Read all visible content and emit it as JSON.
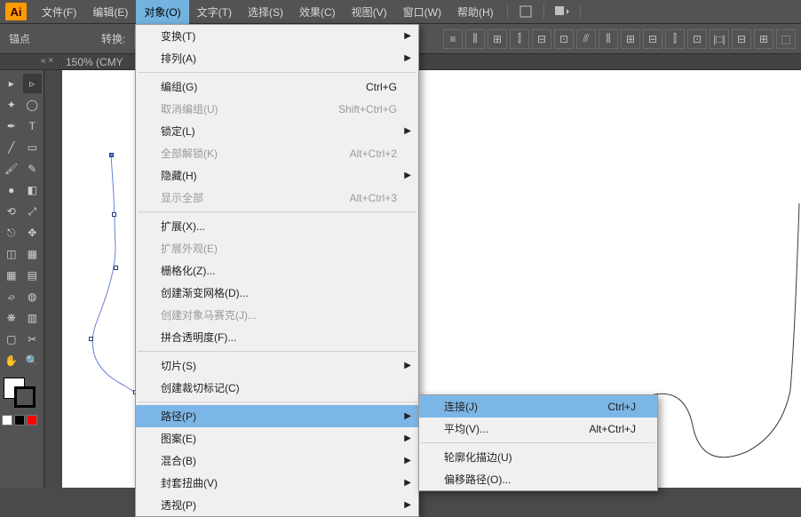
{
  "logo": "Ai",
  "menubar": [
    "文件(F)",
    "编辑(E)",
    "对象(O)",
    "文字(T)",
    "选择(S)",
    "效果(C)",
    "视图(V)",
    "窗口(W)",
    "帮助(H)"
  ],
  "menubar_active_index": 2,
  "toolbar": {
    "anchor_label": "锚点",
    "convert_label": "转换:"
  },
  "docbar": {
    "zoom_label": "150% (CMY",
    "close": "« ×"
  },
  "dropdown": [
    {
      "label": "变换(T)",
      "sub": true
    },
    {
      "label": "排列(A)",
      "sub": true
    },
    {
      "sep": true
    },
    {
      "label": "编组(G)",
      "shortcut": "Ctrl+G"
    },
    {
      "label": "取消编组(U)",
      "shortcut": "Shift+Ctrl+G",
      "disabled": true
    },
    {
      "label": "锁定(L)",
      "sub": true
    },
    {
      "label": "全部解锁(K)",
      "shortcut": "Alt+Ctrl+2",
      "disabled": true
    },
    {
      "label": "隐藏(H)",
      "sub": true
    },
    {
      "label": "显示全部",
      "shortcut": "Alt+Ctrl+3",
      "disabled": true
    },
    {
      "sep": true
    },
    {
      "label": "扩展(X)..."
    },
    {
      "label": "扩展外观(E)",
      "disabled": true
    },
    {
      "label": "栅格化(Z)..."
    },
    {
      "label": "创建渐变网格(D)..."
    },
    {
      "label": "创建对象马赛克(J)...",
      "disabled": true
    },
    {
      "label": "拼合透明度(F)..."
    },
    {
      "sep": true
    },
    {
      "label": "切片(S)",
      "sub": true
    },
    {
      "label": "创建裁切标记(C)"
    },
    {
      "sep": true
    },
    {
      "label": "路径(P)",
      "sub": true,
      "hover": true
    },
    {
      "label": "图案(E)",
      "sub": true
    },
    {
      "label": "混合(B)",
      "sub": true
    },
    {
      "label": "封套扭曲(V)",
      "sub": true
    },
    {
      "label": "透视(P)",
      "sub": true
    }
  ],
  "submenu": [
    {
      "label": "连接(J)",
      "shortcut": "Ctrl+J",
      "hover": true
    },
    {
      "label": "平均(V)...",
      "shortcut": "Alt+Ctrl+J"
    },
    {
      "sep": true
    },
    {
      "label": "轮廓化描边(U)"
    },
    {
      "label": "偏移路径(O)..."
    }
  ],
  "tools": [
    [
      "selection",
      "direct-selection"
    ],
    [
      "magic-wand",
      "lasso"
    ],
    [
      "pen",
      "type"
    ],
    [
      "line",
      "rectangle"
    ],
    [
      "paintbrush",
      "pencil"
    ],
    [
      "blob-brush",
      "eraser"
    ],
    [
      "rotate",
      "scale"
    ],
    [
      "width",
      "free-transform"
    ],
    [
      "shape-builder",
      "perspective"
    ],
    [
      "mesh",
      "gradient"
    ],
    [
      "eyedropper",
      "blend"
    ],
    [
      "symbol-sprayer",
      "graph"
    ],
    [
      "artboard",
      "slice"
    ],
    [
      "hand",
      "zoom"
    ]
  ],
  "mini_swatches": [
    "#ffffff",
    "#000000",
    "#ff0000"
  ]
}
